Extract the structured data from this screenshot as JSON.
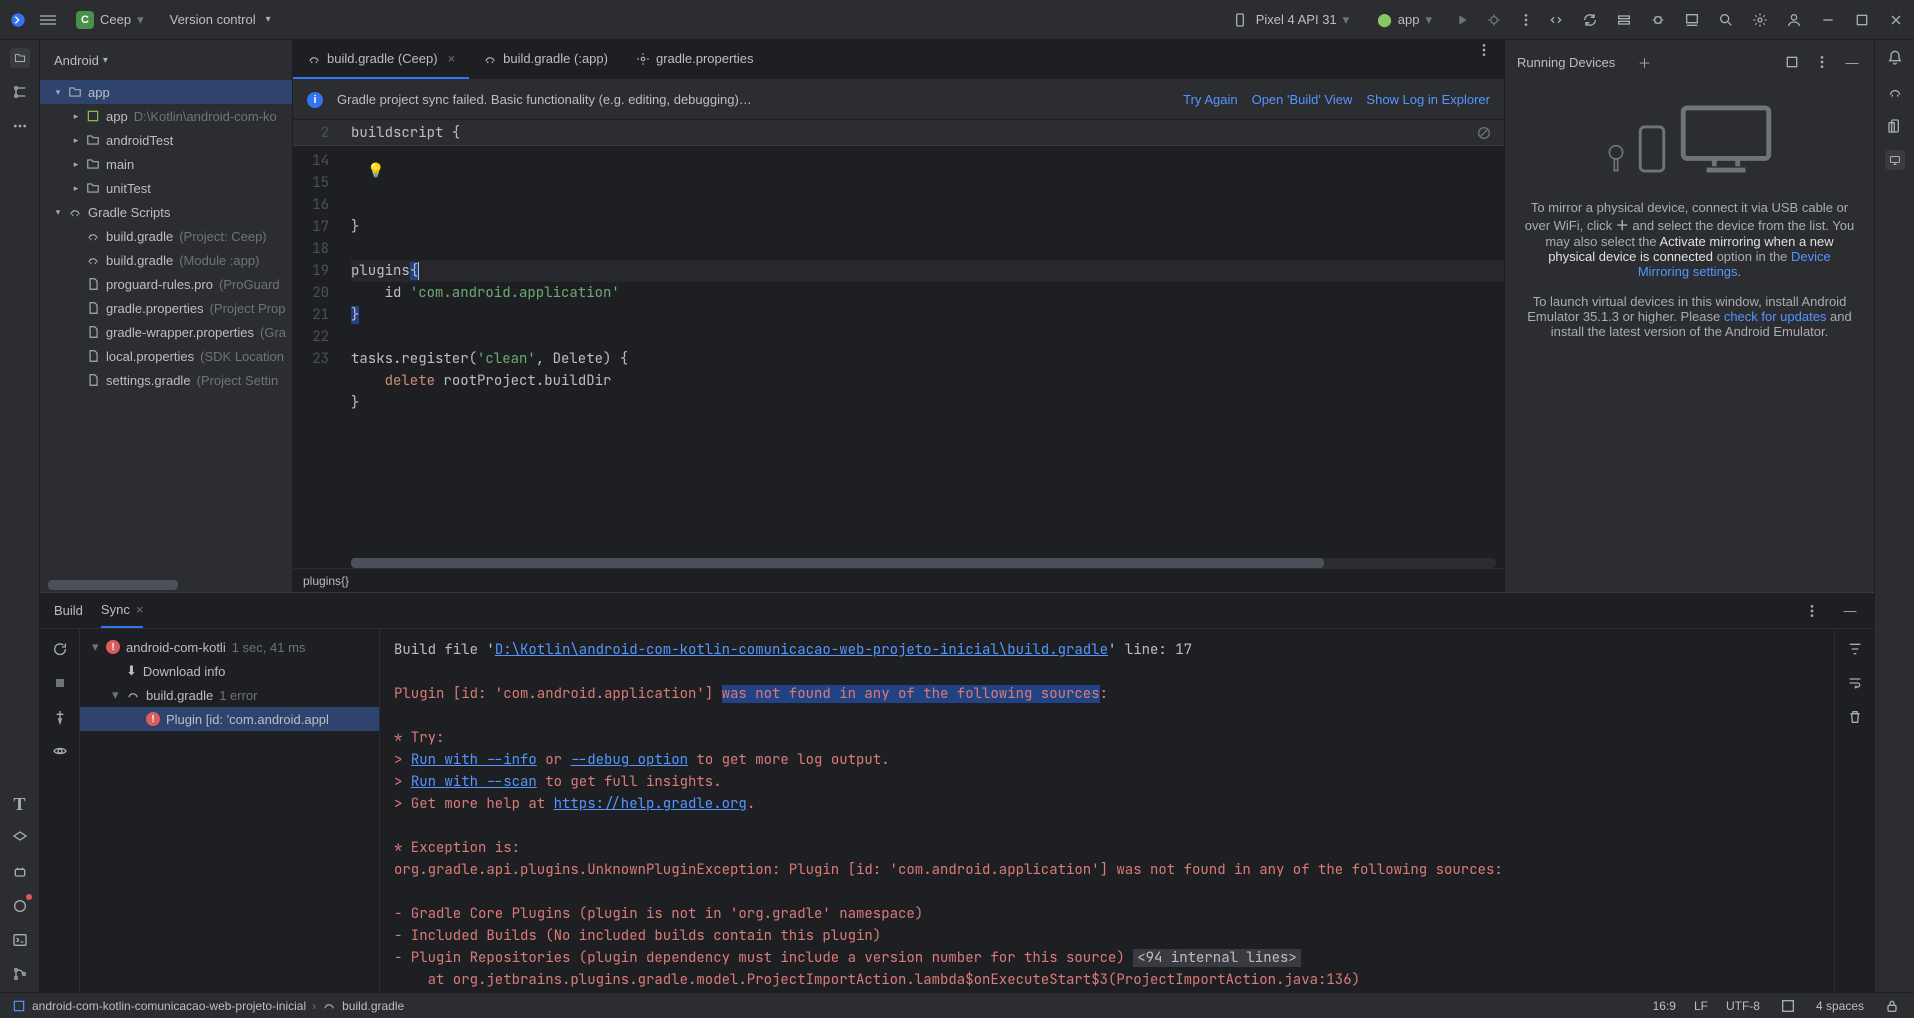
{
  "titlebar": {
    "project_initial": "C",
    "project_name": "Ceep",
    "vcs": "Version control",
    "device": "Pixel 4 API 31",
    "run_config": "app"
  },
  "project": {
    "title": "Android",
    "tree": [
      {
        "depth": 0,
        "twist": "down",
        "icon": "folder",
        "label": "app",
        "selected": true
      },
      {
        "depth": 1,
        "twist": "right",
        "icon": "module",
        "label": "app",
        "hint": "D:\\Kotlin\\android-com-ko"
      },
      {
        "depth": 1,
        "twist": "right",
        "icon": "folder",
        "label": "androidTest"
      },
      {
        "depth": 1,
        "twist": "right",
        "icon": "folder",
        "label": "main"
      },
      {
        "depth": 1,
        "twist": "right",
        "icon": "folder",
        "label": "unitTest"
      },
      {
        "depth": 0,
        "twist": "down",
        "icon": "gradle",
        "label": "Gradle Scripts"
      },
      {
        "depth": 1,
        "twist": "",
        "icon": "gradle",
        "label": "build.gradle",
        "hint": "(Project: Ceep)"
      },
      {
        "depth": 1,
        "twist": "",
        "icon": "gradle",
        "label": "build.gradle",
        "hint": "(Module :app)"
      },
      {
        "depth": 1,
        "twist": "",
        "icon": "file",
        "label": "proguard-rules.pro",
        "hint": "(ProGuard "
      },
      {
        "depth": 1,
        "twist": "",
        "icon": "file",
        "label": "gradle.properties",
        "hint": "(Project Prop"
      },
      {
        "depth": 1,
        "twist": "",
        "icon": "file",
        "label": "gradle-wrapper.properties",
        "hint": "(Gra"
      },
      {
        "depth": 1,
        "twist": "",
        "icon": "file",
        "label": "local.properties",
        "hint": "(SDK Location"
      },
      {
        "depth": 1,
        "twist": "",
        "icon": "file",
        "label": "settings.gradle",
        "hint": "(Project Settin"
      }
    ]
  },
  "tabs": [
    {
      "icon": "gradle",
      "label": "build.gradle (Ceep)",
      "active": true,
      "closable": true
    },
    {
      "icon": "gradle",
      "label": "build.gradle (:app)",
      "active": false
    },
    {
      "icon": "gear",
      "label": "gradle.properties",
      "active": false
    }
  ],
  "notification": {
    "msg": "Gradle project sync failed. Basic functionality (e.g. editing, debugging)…",
    "links": [
      "Try Again",
      "Open 'Build' View",
      "Show Log in Explorer"
    ]
  },
  "editor": {
    "sticky": {
      "num": "2",
      "text": "buildscript {"
    },
    "lines": [
      {
        "num": "14",
        "html": "}"
      },
      {
        "num": "15",
        "html": ""
      },
      {
        "num": "16",
        "html": "<span class='cursor-line'>plugins<span class='sel'>{</span><span class='caret-char'></span></span>"
      },
      {
        "num": "17",
        "html": "    id <span class='str'>'com.android.application'</span>"
      },
      {
        "num": "18",
        "html": "<span class='sel'>}</span>"
      },
      {
        "num": "19",
        "html": ""
      },
      {
        "num": "20",
        "html": "tasks.register(<span class='str'>'clean'</span>, Delete) {"
      },
      {
        "num": "21",
        "html": "    <span class='kw'>delete</span> rootProject.buildDir"
      },
      {
        "num": "22",
        "html": "}"
      },
      {
        "num": "23",
        "html": ""
      }
    ],
    "breadcrumb": "plugins{}"
  },
  "devices": {
    "title": "Running Devices",
    "p1a": "To mirror a physical device, connect it via USB cable or over WiFi, click ",
    "p1b": " and select the device from the list. You may also select the ",
    "p1bold": "Activate mirroring when a new physical device is connected",
    "p1c": " option in the ",
    "p1link": "Device Mirroring settings",
    "p2a": "To launch virtual devices in this window, install Android Emulator 35.1.3 or higher. Please ",
    "p2link": "check for updates",
    "p2b": " and install the latest version of the Android Emulator."
  },
  "build": {
    "tab_build": "Build",
    "tab_sync": "Sync",
    "tree": [
      {
        "depth": 0,
        "twist": "down",
        "err": true,
        "label": "android-com-kotli",
        "hint": "1 sec, 41 ms"
      },
      {
        "depth": 1,
        "twist": "",
        "icon": "dl",
        "label": "Download info"
      },
      {
        "depth": 1,
        "twist": "down",
        "icon": "gradle",
        "label": "build.gradle",
        "hint": "1 error"
      },
      {
        "depth": 2,
        "twist": "",
        "err": true,
        "label": "Plugin [id: 'com.android.appl",
        "sel": true
      }
    ],
    "output": [
      {
        "t": "Build file '",
        "c": ""
      },
      {
        "t": "D:\\Kotlin\\android-com-kotlin-comunicacao-web-projeto-inicial\\build.gradle",
        "c": "lnk"
      },
      {
        "t": "' line: 17",
        "c": ""
      },
      {
        "br": 1
      },
      {
        "br": 1
      },
      {
        "t": "Plugin [id: 'com.android.application'] ",
        "c": "r"
      },
      {
        "t": "was not found in any of the following sources",
        "c": "hl"
      },
      {
        "t": ":",
        "c": "r"
      },
      {
        "br": 1
      },
      {
        "br": 1
      },
      {
        "t": "* Try:",
        "c": "r"
      },
      {
        "br": 1
      },
      {
        "t": "> ",
        "c": "r"
      },
      {
        "t": "Run with --info",
        "c": "lnk"
      },
      {
        "t": " or ",
        "c": "r"
      },
      {
        "t": "--debug option",
        "c": "lnk"
      },
      {
        "t": " to get more log output.",
        "c": "r"
      },
      {
        "br": 1
      },
      {
        "t": "> ",
        "c": "r"
      },
      {
        "t": "Run with --scan",
        "c": "lnk"
      },
      {
        "t": " to get full insights.",
        "c": "r"
      },
      {
        "br": 1
      },
      {
        "t": "> Get more help at ",
        "c": "r"
      },
      {
        "t": "https://help.gradle.org",
        "c": "lnk"
      },
      {
        "t": ".",
        "c": "r"
      },
      {
        "br": 1
      },
      {
        "br": 1
      },
      {
        "t": "* Exception is:",
        "c": "r"
      },
      {
        "br": 1
      },
      {
        "t": "org.gradle.api.plugins.UnknownPluginException: Plugin [id: 'com.android.application'] was not found in any of the following sources:",
        "c": "r"
      },
      {
        "br": 1
      },
      {
        "br": 1
      },
      {
        "t": "- Gradle Core Plugins (plugin is not in 'org.gradle' namespace)",
        "c": "r"
      },
      {
        "br": 1
      },
      {
        "t": "- Included Builds (No included builds contain this plugin)",
        "c": "r"
      },
      {
        "br": 1
      },
      {
        "t": "- Plugin Repositories (plugin dependency must include a version number for this source) ",
        "c": "r"
      },
      {
        "t": "<94 internal lines>",
        "c": "grey-badge"
      },
      {
        "br": 1
      },
      {
        "t": "    at org.jetbrains.plugins.gradle.model.ProjectImportAction.lambda$onExecuteStart$3(ProjectImportAction.java:136)",
        "c": "r"
      },
      {
        "br": 1
      }
    ]
  },
  "status": {
    "crumb1": "android-com-kotlin-comunicacao-web-projeto-inicial",
    "crumb2": "build.gradle",
    "pos": "16:9",
    "le": "LF",
    "enc": "UTF-8",
    "indent": "4 spaces"
  }
}
